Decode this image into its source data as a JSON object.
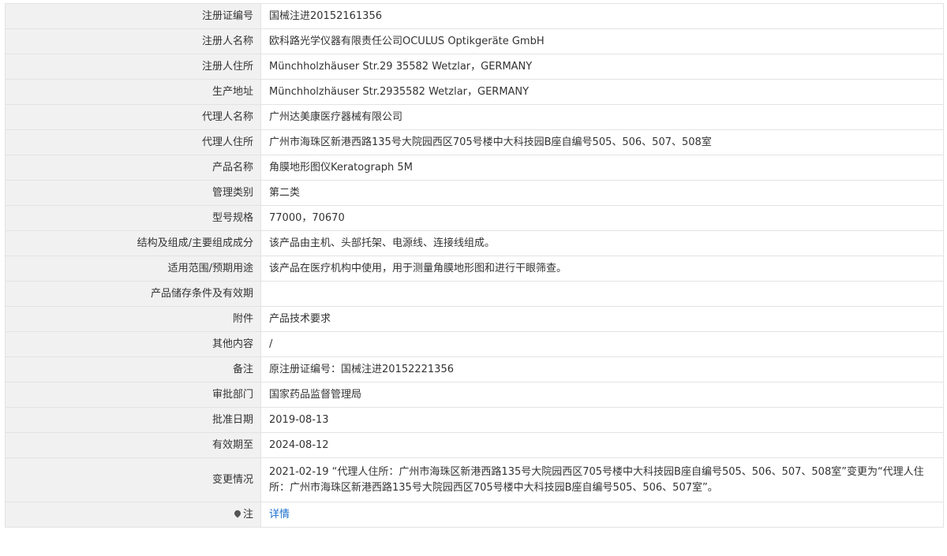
{
  "rows": [
    {
      "label": "注册证编号",
      "value": "国械注进20152161356"
    },
    {
      "label": "注册人名称",
      "value": "欧科路光学仪器有限责任公司OCULUS Optikgeräte GmbH"
    },
    {
      "label": "注册人住所",
      "value": "Münchholzhäuser Str.29 35582 Wetzlar，GERMANY"
    },
    {
      "label": "生产地址",
      "value": "Münchholzhäuser Str.2935582 Wetzlar，GERMANY"
    },
    {
      "label": "代理人名称",
      "value": "广州达美康医疗器械有限公司"
    },
    {
      "label": "代理人住所",
      "value": "广州市海珠区新港西路135号大院园西区705号楼中大科技园B座自编号505、506、507、508室"
    },
    {
      "label": "产品名称",
      "value": "角膜地形图仪Keratograph 5M"
    },
    {
      "label": "管理类别",
      "value": "第二类"
    },
    {
      "label": "型号规格",
      "value": "77000，70670"
    },
    {
      "label": "结构及组成/主要组成成分",
      "value": "该产品由主机、头部托架、电源线、连接线组成。"
    },
    {
      "label": "适用范围/预期用途",
      "value": "该产品在医疗机构中使用，用于测量角膜地形图和进行干眼筛查。"
    },
    {
      "label": "产品储存条件及有效期",
      "value": ""
    },
    {
      "label": "附件",
      "value": "产品技术要求"
    },
    {
      "label": "其他内容",
      "value": "/"
    },
    {
      "label": "备注",
      "value": "原注册证编号：国械注进20152221356"
    },
    {
      "label": "审批部门",
      "value": "国家药品监督管理局"
    },
    {
      "label": "批准日期",
      "value": "2019-08-13"
    },
    {
      "label": "有效期至",
      "value": "2024-08-12"
    },
    {
      "label": "变更情况",
      "value": "2021-02-19 “代理人住所：广州市海珠区新港西路135号大院园西区705号楼中大科技园B座自编号505、506、507、508室”变更为“代理人住所：广州市海珠区新港西路135号大院园西区705号楼中大科技园B座自编号505、506、507室”。"
    }
  ],
  "note_row": {
    "icon": "map-pin-icon",
    "label": "注",
    "link_text": "详情"
  },
  "colors": {
    "label_bg": "#f1f1f1",
    "border": "#e3e3e3",
    "link": "#1a6fd0"
  }
}
